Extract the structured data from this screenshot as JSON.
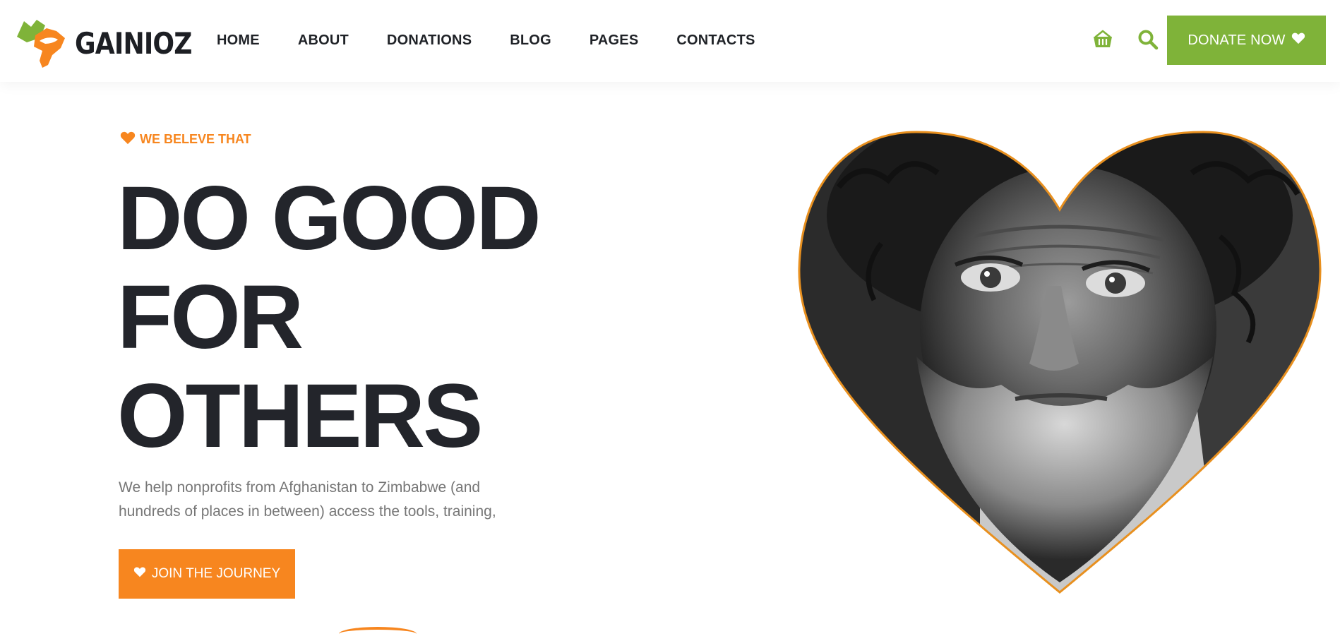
{
  "colors": {
    "brand_green": "#7fb339",
    "accent_orange": "#f7861f",
    "text_dark": "#23252b",
    "text_muted": "#767676"
  },
  "header": {
    "logo_text": "GAINIOZ",
    "logo_icon": "map-hand-logo-icon",
    "nav": [
      "HOME",
      "ABOUT",
      "DONATIONS",
      "BLOG",
      "PAGES",
      "CONTACTS"
    ],
    "icons": [
      "basket-icon",
      "search-icon"
    ],
    "donate_label": "DONATE NOW",
    "donate_icon": "heart-icon"
  },
  "hero": {
    "tagline": "WE BELEVE THAT",
    "tagline_icon": "heart-icon",
    "headline": [
      "DO GOOD",
      "FOR",
      "OTHERS"
    ],
    "description": "We help nonprofits from Afghanistan to Zimbabwe (and hundreds of places in between) access the tools, training,",
    "cta_label": "JOIN THE JOURNEY",
    "cta_icon": "heart-icon",
    "image": "heart-framed-portrait"
  }
}
